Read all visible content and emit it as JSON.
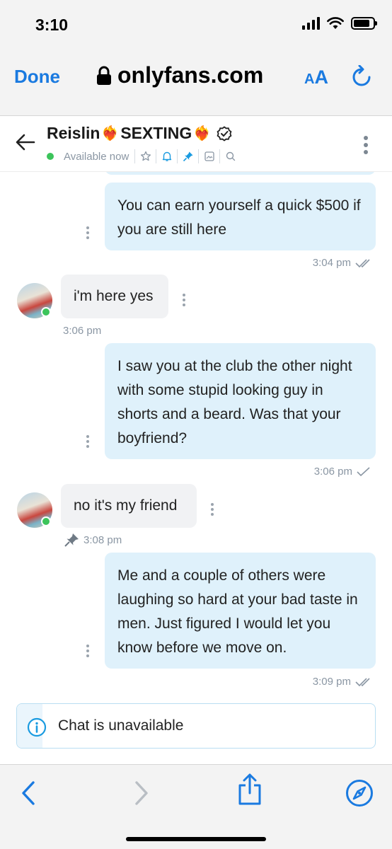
{
  "status_bar": {
    "time": "3:10"
  },
  "browser": {
    "done_label": "Done",
    "url": "onlyfans.com",
    "aa_small": "A",
    "aa_big": "A",
    "icons": [
      "lock-icon",
      "reload-icon",
      "back-icon",
      "forward-icon",
      "share-icon",
      "compass-icon"
    ]
  },
  "chat_header": {
    "contact_name": "Reislin",
    "heart1": "❤️‍🔥",
    "name_suffix": "SEXTING",
    "heart2": "❤️‍🔥",
    "presence": "Available now",
    "icons": [
      "star-icon",
      "bell-icon",
      "pin-icon",
      "image-icon",
      "search-icon"
    ]
  },
  "messages": [
    {
      "direction": "out",
      "text": "You can earn yourself a quick $500 if you are still here",
      "time": "3:04 pm",
      "status": "read"
    },
    {
      "direction": "in",
      "text": "i'm here yes",
      "time": "3:06 pm"
    },
    {
      "direction": "out",
      "text": "I saw you at the club the other night with some stupid looking guy in shorts and a beard. Was that your boyfriend?",
      "time": "3:06 pm",
      "status": "sent"
    },
    {
      "direction": "in",
      "text": "no it's my friend",
      "time": "3:08 pm",
      "pinned": true
    },
    {
      "direction": "out",
      "text": "Me and a couple of others were laughing so hard at your bad taste in men. Just figured I would let you know before we move on.",
      "time": "3:09 pm",
      "status": "read"
    }
  ],
  "notice": {
    "text": "Chat is unavailable"
  },
  "colors": {
    "accent": "#1a7ae0",
    "outgoing_bubble": "#dff1fb",
    "incoming_bubble": "#f1f2f4",
    "online": "#3cc45b",
    "meta_text": "#8a96a3"
  }
}
